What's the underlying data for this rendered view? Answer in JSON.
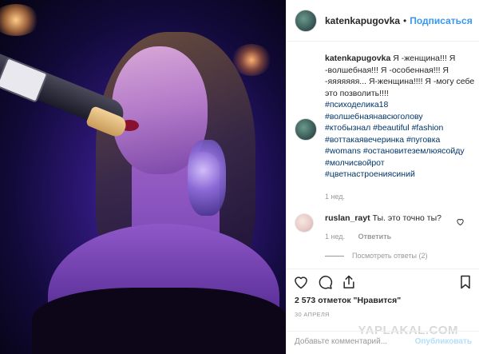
{
  "post": {
    "username": "katenkapugovka",
    "separator": "•",
    "follow_label": "Подписаться",
    "caption_text": "Я -женщина!!! Я -волшебная!!! Я -особенная!!! Я -яяяяяяя... Я-женщина!!!! Я -могу себе это позволить!!!!",
    "hashtags": [
      "#психоделика18",
      "#волшебнаянавсюголову",
      "#ктобызнал #beautiful #fashion",
      "#воттакаявечеринка #пуговка",
      "#womans #остановитеземлюясойду",
      "#молчисвойрот",
      "#цветнастроениясиний"
    ],
    "caption_time": "1 нед.",
    "likes": "2 573 отметок \"Нравится\"",
    "date": "30 АПРЕЛЯ"
  },
  "comment": {
    "username": "ruslan_rayt",
    "text": "Ты. это точно ты?",
    "time": "1 нед.",
    "reply_label": "Ответить",
    "view_replies": "Посмотреть ответы (2)"
  },
  "add_comment": {
    "placeholder": "Добавьте комментарий...",
    "publish_label": "Опубликовать"
  },
  "watermark": "YAPLAKAL.COM",
  "colors": {
    "link_blue": "#3897f0",
    "hashtag": "#003569",
    "muted": "#999999"
  }
}
